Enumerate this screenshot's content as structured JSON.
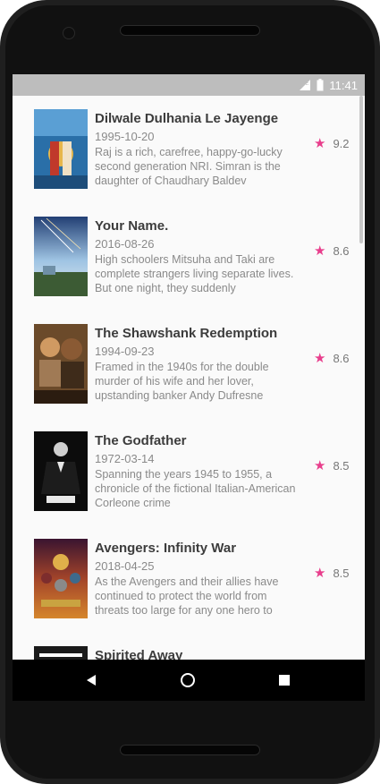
{
  "status_bar": {
    "time": "11:41",
    "icons": [
      "lte-signal-icon",
      "battery-icon"
    ]
  },
  "movies": [
    {
      "title": "Dilwale Dulhania Le Jayenge",
      "release_date": "1995-10-20",
      "overview": "Raj is a rich, carefree, happy-go-lucky second generation NRI. Simran is the daughter of Chaudhary Baldev",
      "rating": "9.2",
      "poster_colors": [
        "#2a6fa8",
        "#e7b64a"
      ]
    },
    {
      "title": "Your Name.",
      "release_date": "2016-08-26",
      "overview": "High schoolers Mitsuha and Taki are complete strangers living separate lives. But one night, they suddenly",
      "rating": "8.6",
      "poster_colors": [
        "#3d5f9a",
        "#9fc4e3"
      ]
    },
    {
      "title": "The Shawshank Redemption",
      "release_date": "1994-09-23",
      "overview": "Framed in the 1940s for the double murder of his wife and her lover, upstanding banker Andy Dufresne",
      "rating": "8.6",
      "poster_colors": [
        "#6b4a2a",
        "#d09a62"
      ]
    },
    {
      "title": "The Godfather",
      "release_date": "1972-03-14",
      "overview": "Spanning the years 1945 to 1955, a chronicle of the fictional Italian-American Corleone crime",
      "rating": "8.5",
      "poster_colors": [
        "#0c0c0c",
        "#e8e8e8"
      ]
    },
    {
      "title": "Avengers: Infinity War",
      "release_date": "2018-04-25",
      "overview": "As the Avengers and their allies have continued to protect the world from threats too large for any one hero to",
      "rating": "8.5",
      "poster_colors": [
        "#5a1b2e",
        "#d5862c"
      ]
    },
    {
      "title": "Spirited Away",
      "release_date": "",
      "overview": "",
      "rating": "",
      "poster_colors": [
        "#1a1a1a",
        "#ffffff"
      ]
    }
  ],
  "nav": {
    "icons": [
      "back-icon",
      "home-icon",
      "recents-icon"
    ]
  },
  "accent_color": "#e83e8c"
}
